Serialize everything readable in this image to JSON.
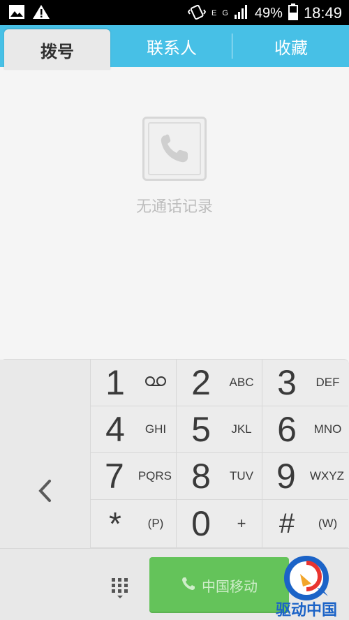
{
  "status_bar": {
    "battery_percent": "49%",
    "time": "18:49",
    "network_label": "G",
    "network_label_2": "E"
  },
  "tabs": [
    {
      "label": "拨号",
      "active": true
    },
    {
      "label": "联系人",
      "active": false
    },
    {
      "label": "收藏",
      "active": false
    }
  ],
  "empty_state": {
    "text": "无通话记录",
    "icon": "phone-icon"
  },
  "dialpad": {
    "keys": [
      {
        "digit": "1",
        "letters": ""
      },
      {
        "digit": "2",
        "letters": "ABC"
      },
      {
        "digit": "3",
        "letters": "DEF"
      },
      {
        "digit": "4",
        "letters": "GHI"
      },
      {
        "digit": "5",
        "letters": "JKL"
      },
      {
        "digit": "6",
        "letters": "MNO"
      },
      {
        "digit": "7",
        "letters": "PQRS"
      },
      {
        "digit": "8",
        "letters": "TUV"
      },
      {
        "digit": "9",
        "letters": "WXYZ"
      },
      {
        "digit": "*",
        "letters": "(P)"
      },
      {
        "digit": "0",
        "letters": "+"
      },
      {
        "digit": "#",
        "letters": "(W)"
      }
    ],
    "call_button_label": "中国移动"
  },
  "watermark": {
    "text": "驱动中国"
  },
  "colors": {
    "tab_bar": "#47c0e6",
    "call_button": "#64c35a",
    "watermark_blue": "#1b63c7"
  }
}
